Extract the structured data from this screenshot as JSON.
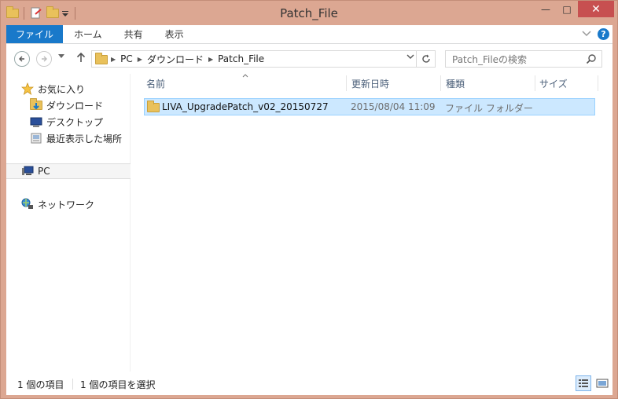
{
  "window": {
    "title": "Patch_File",
    "buttons": {
      "minimize": "—",
      "maximize": "□",
      "close": "✕"
    }
  },
  "ribbon": {
    "tabs": [
      "ファイル",
      "ホーム",
      "共有",
      "表示"
    ],
    "expand_icon": "chevron-down-icon",
    "help_label": "?"
  },
  "address": {
    "crumbs": [
      "PC",
      "ダウンロード",
      "Patch_File"
    ],
    "search_placeholder": "Patch_Fileの検索"
  },
  "navpane": {
    "items": [
      {
        "label": "お気に入り",
        "icon": "star-icon"
      },
      {
        "label": "ダウンロード",
        "icon": "downloads-folder-icon"
      },
      {
        "label": "デスクトップ",
        "icon": "desktop-icon"
      },
      {
        "label": "最近表示した場所",
        "icon": "recent-places-icon"
      },
      {
        "label": "PC",
        "icon": "pc-icon"
      },
      {
        "label": "ネットワーク",
        "icon": "network-icon"
      }
    ]
  },
  "columns": [
    "名前",
    "更新日時",
    "種類",
    "サイズ"
  ],
  "files": [
    {
      "name": "LIVA_UpgradePatch_v02_20150727",
      "modified": "2015/08/04 11:09",
      "type": "ファイル フォルダー",
      "size": ""
    }
  ],
  "status": {
    "item_count": "1 個の項目",
    "selected": "1 個の項目を選択"
  },
  "colors": {
    "frame": "#dca792",
    "accent": "#1979ca",
    "selection": "#cce8ff",
    "close": "#c75050"
  }
}
